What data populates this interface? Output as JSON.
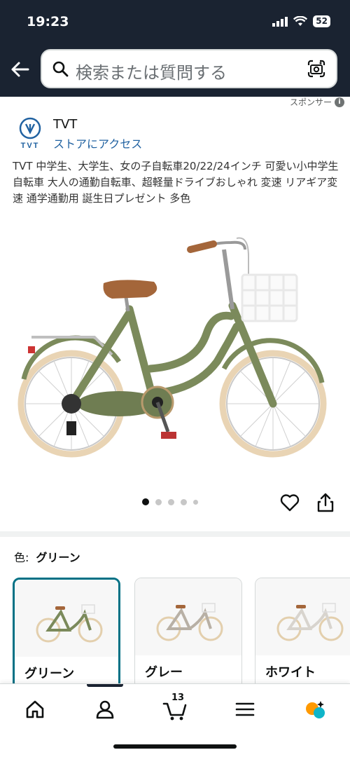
{
  "status_bar": {
    "time": "19:23",
    "battery": "52"
  },
  "search": {
    "placeholder": "検索または質問する"
  },
  "sponsor_label": "スポンサー",
  "brand": {
    "name": "TVT",
    "logo_text": "TVT",
    "store_link": "ストアにアクセス"
  },
  "product": {
    "title": "TVT 中学生、大学生、女の子自転車20/22/24インチ 可愛い小中学生自転車 大人の通勤自転車、超軽量ドライブおしゃれ 変速 リアギア変速 通学通勤用 誕生日プレゼント 多色",
    "image_count": 5,
    "active_image": 1
  },
  "color_selector": {
    "label": "色:",
    "selected": "グリーン",
    "options": [
      {
        "name": "グリーン",
        "frame_color": "#7b8a5b"
      },
      {
        "name": "グレー",
        "frame_color": "#b8b0a5"
      },
      {
        "name": "ホワイト",
        "frame_color": "#e6e2dc"
      }
    ]
  },
  "bottom_nav": {
    "cart_count": "13"
  },
  "colors": {
    "header_bg": "#1a2331",
    "link": "#2162a1",
    "selected_border": "#007185"
  }
}
